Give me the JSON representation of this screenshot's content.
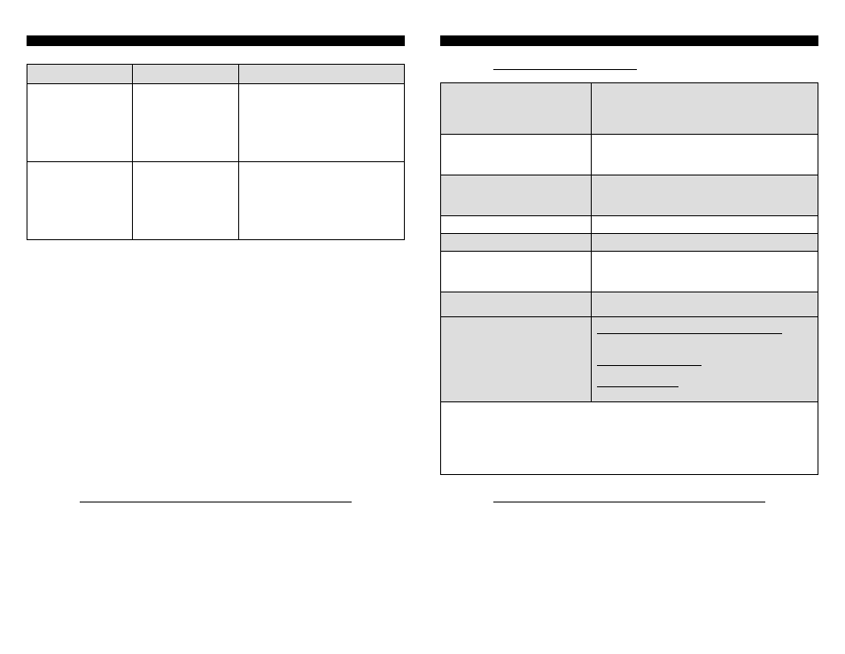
{
  "left": {
    "table": {
      "header": [
        "",
        "",
        ""
      ],
      "rows": [
        [
          "",
          "",
          ""
        ],
        [
          "",
          "",
          ""
        ]
      ]
    }
  },
  "right": {
    "heading_underline": "",
    "rows": [
      {
        "left": "",
        "right": ""
      },
      {
        "left": "",
        "right": ""
      },
      {
        "left": "",
        "right": ""
      },
      {
        "left": "",
        "right": ""
      },
      {
        "left": "",
        "right": ""
      },
      {
        "left": "",
        "right": ""
      },
      {
        "left": "",
        "right": ""
      },
      {
        "left": "",
        "right_lines": [
          "",
          "",
          ""
        ]
      },
      {
        "full": ""
      }
    ]
  }
}
